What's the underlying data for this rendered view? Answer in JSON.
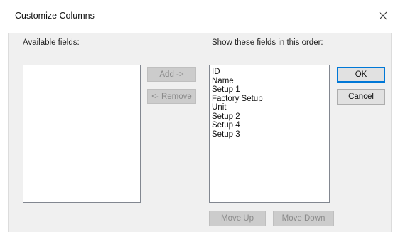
{
  "dialog": {
    "title": "Customize Columns",
    "close_glyph": "close-icon"
  },
  "available": {
    "label": "Available fields:",
    "items": []
  },
  "shown": {
    "label": "Show these fields in this order:",
    "items": [
      "ID",
      "Name",
      "Setup 1",
      "Factory Setup",
      "Unit",
      "Setup 2",
      "Setup 4",
      "Setup 3"
    ]
  },
  "buttons": {
    "add": "Add ->",
    "remove": "<- Remove",
    "ok": "OK",
    "cancel": "Cancel",
    "move_up": "Move Up",
    "move_down": "Move Down"
  },
  "colors": {
    "accent": "#0078d7",
    "client_bg": "#f0f0f0",
    "disabled_bg": "#cccccc",
    "disabled_text": "#8a8a8a"
  }
}
